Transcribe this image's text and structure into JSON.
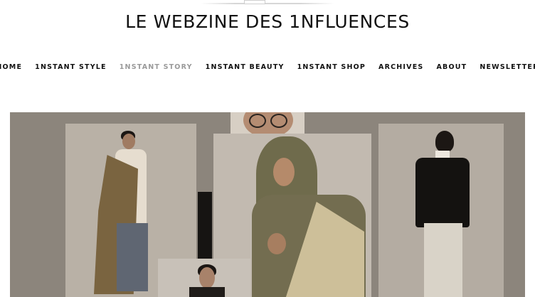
{
  "site": {
    "title": "LE WEBZINE DES 1NFLUENCES"
  },
  "nav": {
    "items": [
      {
        "label": "HOME",
        "active": false
      },
      {
        "label": "1NSTANT STYLE",
        "active": false
      },
      {
        "label": "1NSTANT STORY",
        "active": true
      },
      {
        "label": "1NSTANT BEAUTY",
        "active": false
      },
      {
        "label": "1NSTANT SHOP",
        "active": false
      },
      {
        "label": "ARCHIVES",
        "active": false
      },
      {
        "label": "ABOUT",
        "active": false
      },
      {
        "label": "NEWSLETTER",
        "active": false
      }
    ]
  },
  "colors": {
    "text": "#111111",
    "nav_active": "#9a9a9a",
    "hero_background": "#8c857c"
  }
}
